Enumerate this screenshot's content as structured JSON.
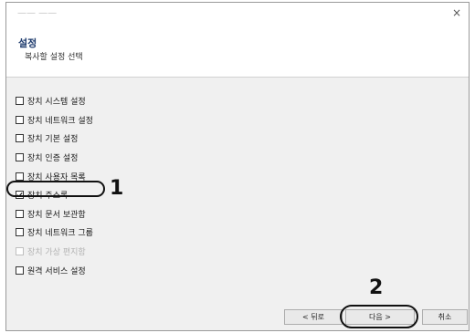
{
  "window": {
    "title": "—— ——",
    "close_symbol": "×"
  },
  "header": {
    "title": "설정",
    "subtitle": "복사할 설정 선택"
  },
  "options": [
    {
      "label": "장치 시스템 설정",
      "checked": false,
      "disabled": false
    },
    {
      "label": "장치 네트워크 설정",
      "checked": false,
      "disabled": false
    },
    {
      "label": "장치 기본 설정",
      "checked": false,
      "disabled": false
    },
    {
      "label": "장치 인증 설정",
      "checked": false,
      "disabled": false
    },
    {
      "label": "장치 사용자 목록",
      "checked": false,
      "disabled": false
    },
    {
      "label": "장치 주소록",
      "checked": true,
      "disabled": false
    },
    {
      "label": "장치 문서 보관함",
      "checked": false,
      "disabled": false
    },
    {
      "label": "장치 네트워크 그룹",
      "checked": false,
      "disabled": false
    },
    {
      "label": "장치 가상 편지함",
      "checked": false,
      "disabled": true
    },
    {
      "label": "원격 서비스 설정",
      "checked": false,
      "disabled": false
    }
  ],
  "callouts": {
    "step1": "1",
    "step2": "2"
  },
  "buttons": {
    "back": "< 뒤로",
    "next": "다음 >",
    "cancel": "취소"
  }
}
